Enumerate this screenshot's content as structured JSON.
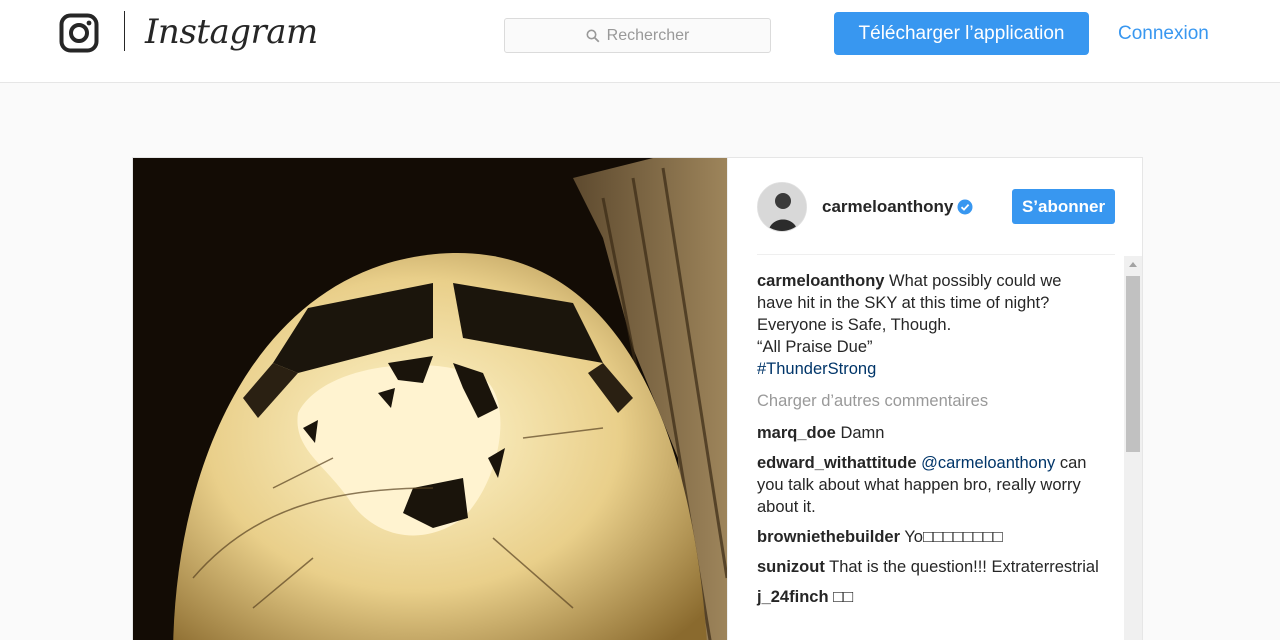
{
  "header": {
    "wordmark": "Instagram",
    "search_placeholder": "Rechercher",
    "download_label": "Télécharger l’application",
    "login_label": "Connexion"
  },
  "post": {
    "username": "carmeloanthony",
    "follow_label": "S’abonner",
    "caption": {
      "username": "carmeloanthony",
      "line1": "What possibly could we",
      "line2": "have hit in the SKY at this time of night?",
      "line3": "Everyone is Safe, Though.",
      "line4": "“All Praise Due”",
      "hashtag": "#ThunderStrong"
    },
    "load_more_label": "Charger d’autres commentaires",
    "comments": [
      {
        "username": "marq_doe",
        "text": "Damn"
      },
      {
        "username": "edward_withattitude",
        "mention": "@carmeloanthony",
        "text": "can you talk about what happen bro, really worry about it."
      },
      {
        "username": "browniethebuilder",
        "text": "Yo□□□□□□□□"
      },
      {
        "username": "sunizout",
        "text": "That is the question!!! Extraterrestrial"
      },
      {
        "username": "j_24finch",
        "text": "□□"
      }
    ]
  },
  "colors": {
    "accent": "#3897f0",
    "link": "#003569",
    "muted": "#999999"
  },
  "icons": [
    "instagram-camera-icon",
    "search-icon",
    "verified-badge-icon",
    "scroll-up-arrow-icon"
  ]
}
